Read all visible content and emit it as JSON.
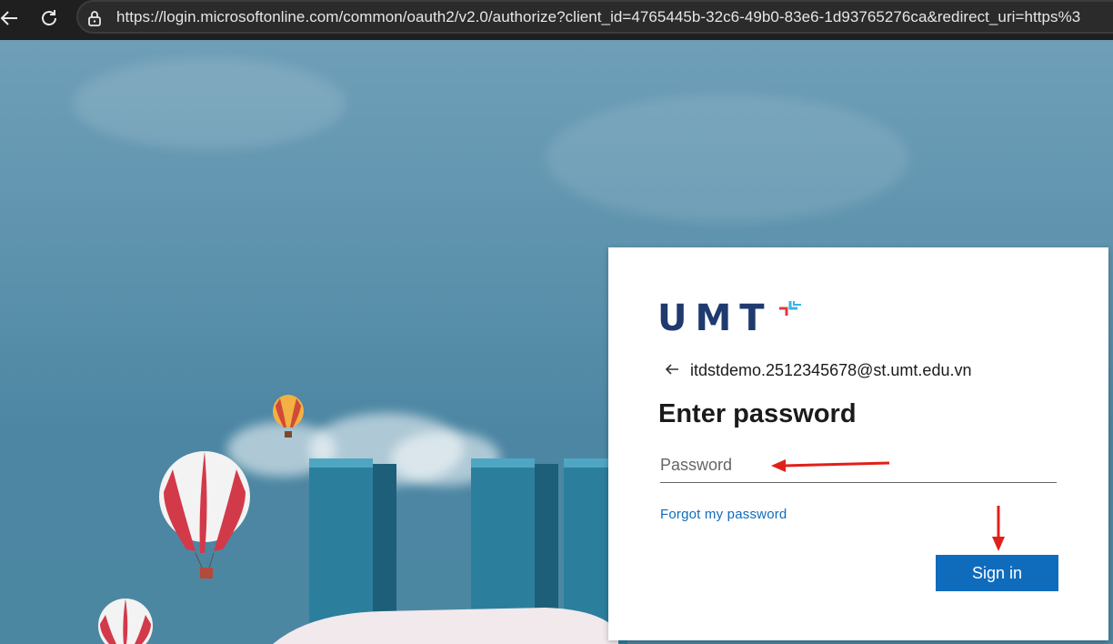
{
  "browser": {
    "url": "https://login.microsoftonline.com/common/oauth2/v2.0/authorize?client_id=4765445b-32c6-49b0-83e6-1d93765276ca&redirect_uri=https%3"
  },
  "login": {
    "logo_text": "UMT",
    "account_email": "itdstdemo.2512345678@st.umt.edu.vn",
    "heading": "Enter password",
    "password_placeholder": "Password",
    "forgot_link": "Forgot my password",
    "signin_label": "Sign in"
  },
  "colors": {
    "brand_navy": "#1f3a6e",
    "link_blue": "#0f6cbd",
    "button_blue": "#0f6cbd",
    "annotation_red": "#e0201a"
  },
  "icons": [
    "back-arrow-icon",
    "reload-icon",
    "lock-icon",
    "back-arrow-icon"
  ]
}
